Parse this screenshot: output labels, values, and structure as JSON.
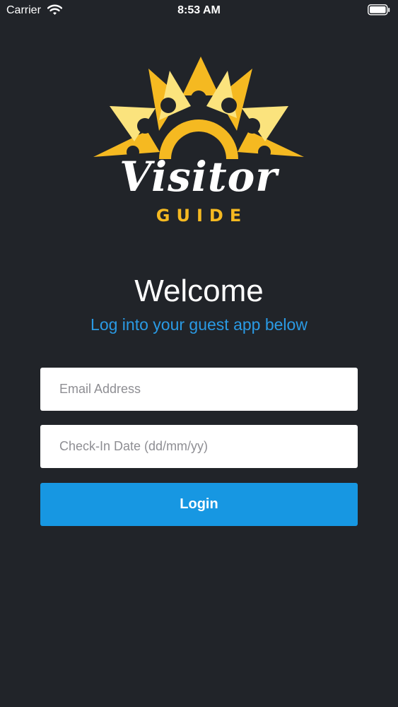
{
  "status_bar": {
    "carrier": "Carrier",
    "time": "8:53 AM",
    "icons": [
      "wifi-icon",
      "battery-icon"
    ]
  },
  "logo": {
    "word_main": "Visitor",
    "word_sub": "GUIDE",
    "colors": {
      "petal_dark": "#f5b921",
      "petal_light": "#fbe37d",
      "word_sub": "#f5b921"
    }
  },
  "welcome": {
    "title": "Welcome",
    "subtitle": "Log into your guest app below"
  },
  "form": {
    "email_placeholder": "Email Address",
    "email_value": "",
    "date_placeholder": "Check-In Date (dd/mm/yy)",
    "date_value": "",
    "login_label": "Login"
  },
  "colors": {
    "background": "#212429",
    "accent": "#1797e2",
    "subtitle": "#2a9ae4"
  }
}
